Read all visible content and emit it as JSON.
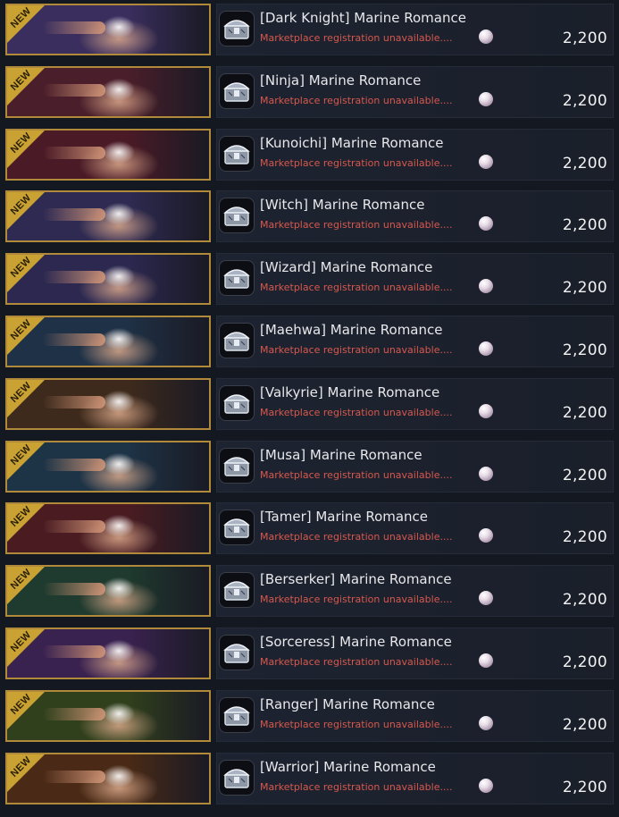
{
  "colors": {
    "background": "#141821",
    "frame_gold": "#b08a3a",
    "ribbon_gold": "#c9a233",
    "status_red": "#d7584e",
    "text_white": "#e8e8ea"
  },
  "items": [
    {
      "badge": "NEW",
      "name": "[Dark Knight] Marine Romance",
      "status": "Marketplace registration unavailable....",
      "currency_icon": "pearl-icon",
      "price": "2,200",
      "thumb_color": "#3a2e5e",
      "item_icon": "treasure-chest-icon"
    },
    {
      "badge": "NEW",
      "name": "[Ninja] Marine Romance",
      "status": "Marketplace registration unavailable....",
      "currency_icon": "pearl-icon",
      "price": "2,200",
      "thumb_color": "#4a1e2a",
      "item_icon": "treasure-chest-icon"
    },
    {
      "badge": "NEW",
      "name": "[Kunoichi] Marine Romance",
      "status": "Marketplace registration unavailable....",
      "currency_icon": "pearl-icon",
      "price": "2,200",
      "thumb_color": "#4a1a26",
      "item_icon": "treasure-chest-icon"
    },
    {
      "badge": "NEW",
      "name": "[Witch] Marine Romance",
      "status": "Marketplace registration unavailable....",
      "currency_icon": "pearl-icon",
      "price": "2,200",
      "thumb_color": "#2e2a52",
      "item_icon": "treasure-chest-icon"
    },
    {
      "badge": "NEW",
      "name": "[Wizard] Marine Romance",
      "status": "Marketplace registration unavailable....",
      "currency_icon": "pearl-icon",
      "price": "2,200",
      "thumb_color": "#2c2850",
      "item_icon": "treasure-chest-icon"
    },
    {
      "badge": "NEW",
      "name": "[Maehwa] Marine Romance",
      "status": "Marketplace registration unavailable....",
      "currency_icon": "pearl-icon",
      "price": "2,200",
      "thumb_color": "#1f3146",
      "item_icon": "treasure-chest-icon"
    },
    {
      "badge": "NEW",
      "name": "[Valkyrie] Marine Romance",
      "status": "Marketplace registration unavailable....",
      "currency_icon": "pearl-icon",
      "price": "2,200",
      "thumb_color": "#3e2a1c",
      "item_icon": "treasure-chest-icon"
    },
    {
      "badge": "NEW",
      "name": "[Musa] Marine Romance",
      "status": "Marketplace registration unavailable....",
      "currency_icon": "pearl-icon",
      "price": "2,200",
      "thumb_color": "#1d3346",
      "item_icon": "treasure-chest-icon"
    },
    {
      "badge": "NEW",
      "name": "[Tamer] Marine Romance",
      "status": "Marketplace registration unavailable....",
      "currency_icon": "pearl-icon",
      "price": "2,200",
      "thumb_color": "#4a1c22",
      "item_icon": "treasure-chest-icon"
    },
    {
      "badge": "NEW",
      "name": "[Berserker] Marine Romance",
      "status": "Marketplace registration unavailable....",
      "currency_icon": "pearl-icon",
      "price": "2,200",
      "thumb_color": "#1f3a2e",
      "item_icon": "treasure-chest-icon"
    },
    {
      "badge": "NEW",
      "name": "[Sorceress] Marine Romance",
      "status": "Marketplace registration unavailable....",
      "currency_icon": "pearl-icon",
      "price": "2,200",
      "thumb_color": "#3a2250",
      "item_icon": "treasure-chest-icon"
    },
    {
      "badge": "NEW",
      "name": "[Ranger] Marine Romance",
      "status": "Marketplace registration unavailable....",
      "currency_icon": "pearl-icon",
      "price": "2,200",
      "thumb_color": "#30401c",
      "item_icon": "treasure-chest-icon"
    },
    {
      "badge": "NEW",
      "name": "[Warrior] Marine Romance",
      "status": "Marketplace registration unavailable....",
      "currency_icon": "pearl-icon",
      "price": "2,200",
      "thumb_color": "#4a2a16",
      "item_icon": "treasure-chest-icon"
    }
  ]
}
